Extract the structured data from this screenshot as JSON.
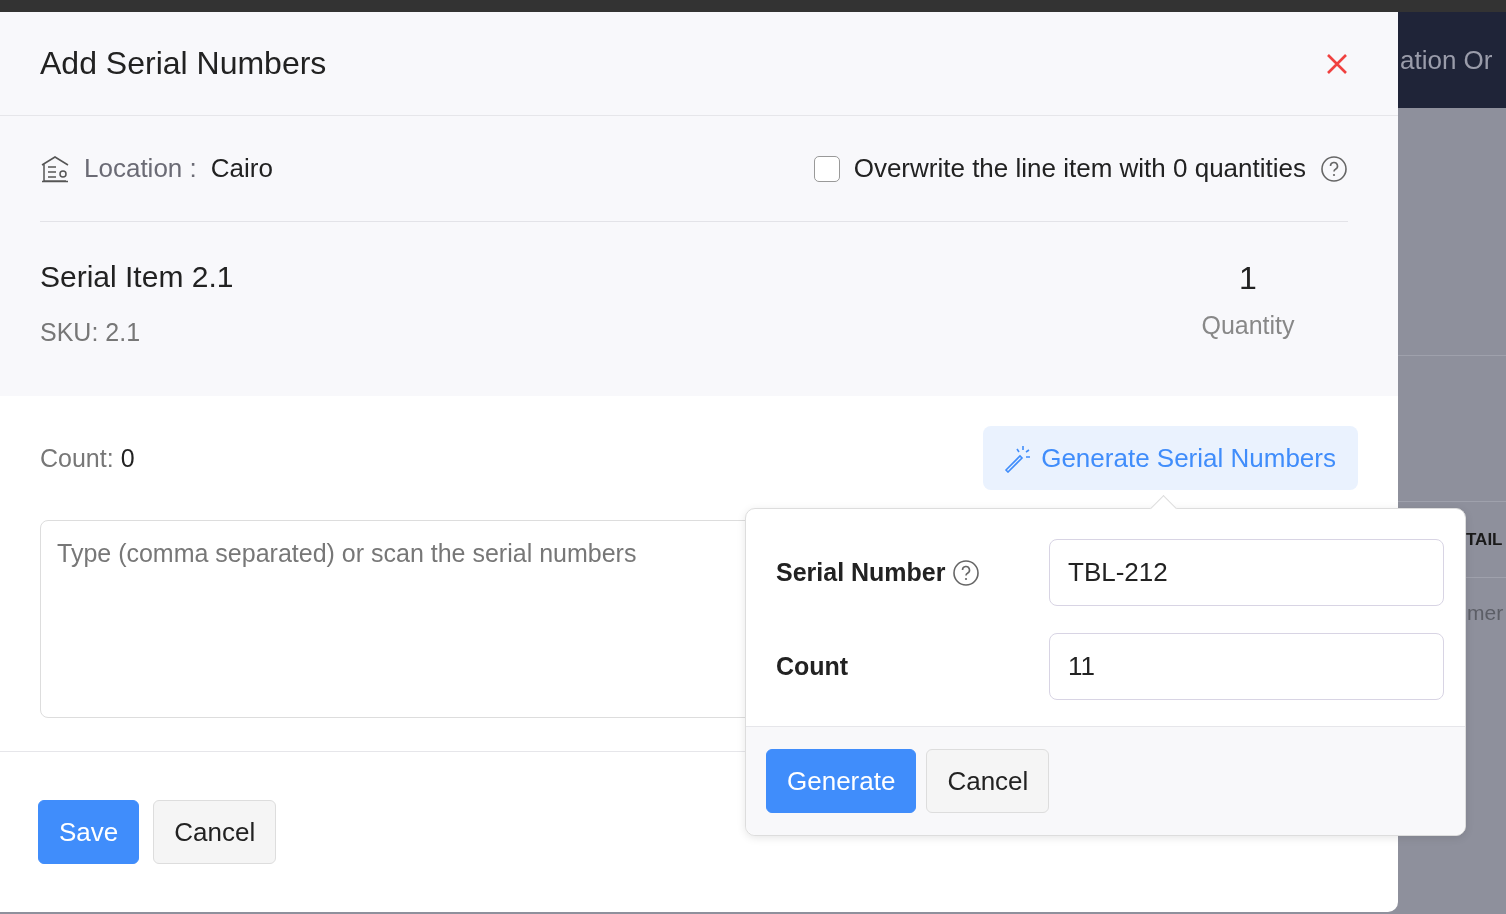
{
  "dialog": {
    "title": "Add Serial Numbers",
    "location_label": "Location :",
    "location": "Cairo",
    "overwrite": {
      "label": "Overwrite the line item with 0 quantities",
      "checked": false
    },
    "item": {
      "name": "Serial Item 2.1",
      "sku": "SKU: 2.1",
      "quantity": "1",
      "quantity_label": "Quantity"
    },
    "count_label": "Count:",
    "count": "0",
    "generate_button": "Generate Serial Numbers",
    "serials": {
      "placeholder": "Type (comma separated) or scan the serial numbers"
    },
    "buttons": [
      {
        "label": "Save",
        "kind": "primary"
      },
      {
        "label": "Cancel",
        "kind": "secondary"
      }
    ]
  },
  "popover": {
    "fields": [
      {
        "label": "Serial Number",
        "help": true,
        "value": "TBL-212"
      },
      {
        "label": "Count",
        "help": false,
        "value": "11"
      }
    ],
    "buttons": [
      {
        "label": "Generate",
        "kind": "primary"
      },
      {
        "label": "Cancel",
        "kind": "secondary"
      }
    ]
  },
  "background": {
    "header_text": "ation Or",
    "column_header": "TAIL",
    "cell_text": "mer"
  }
}
